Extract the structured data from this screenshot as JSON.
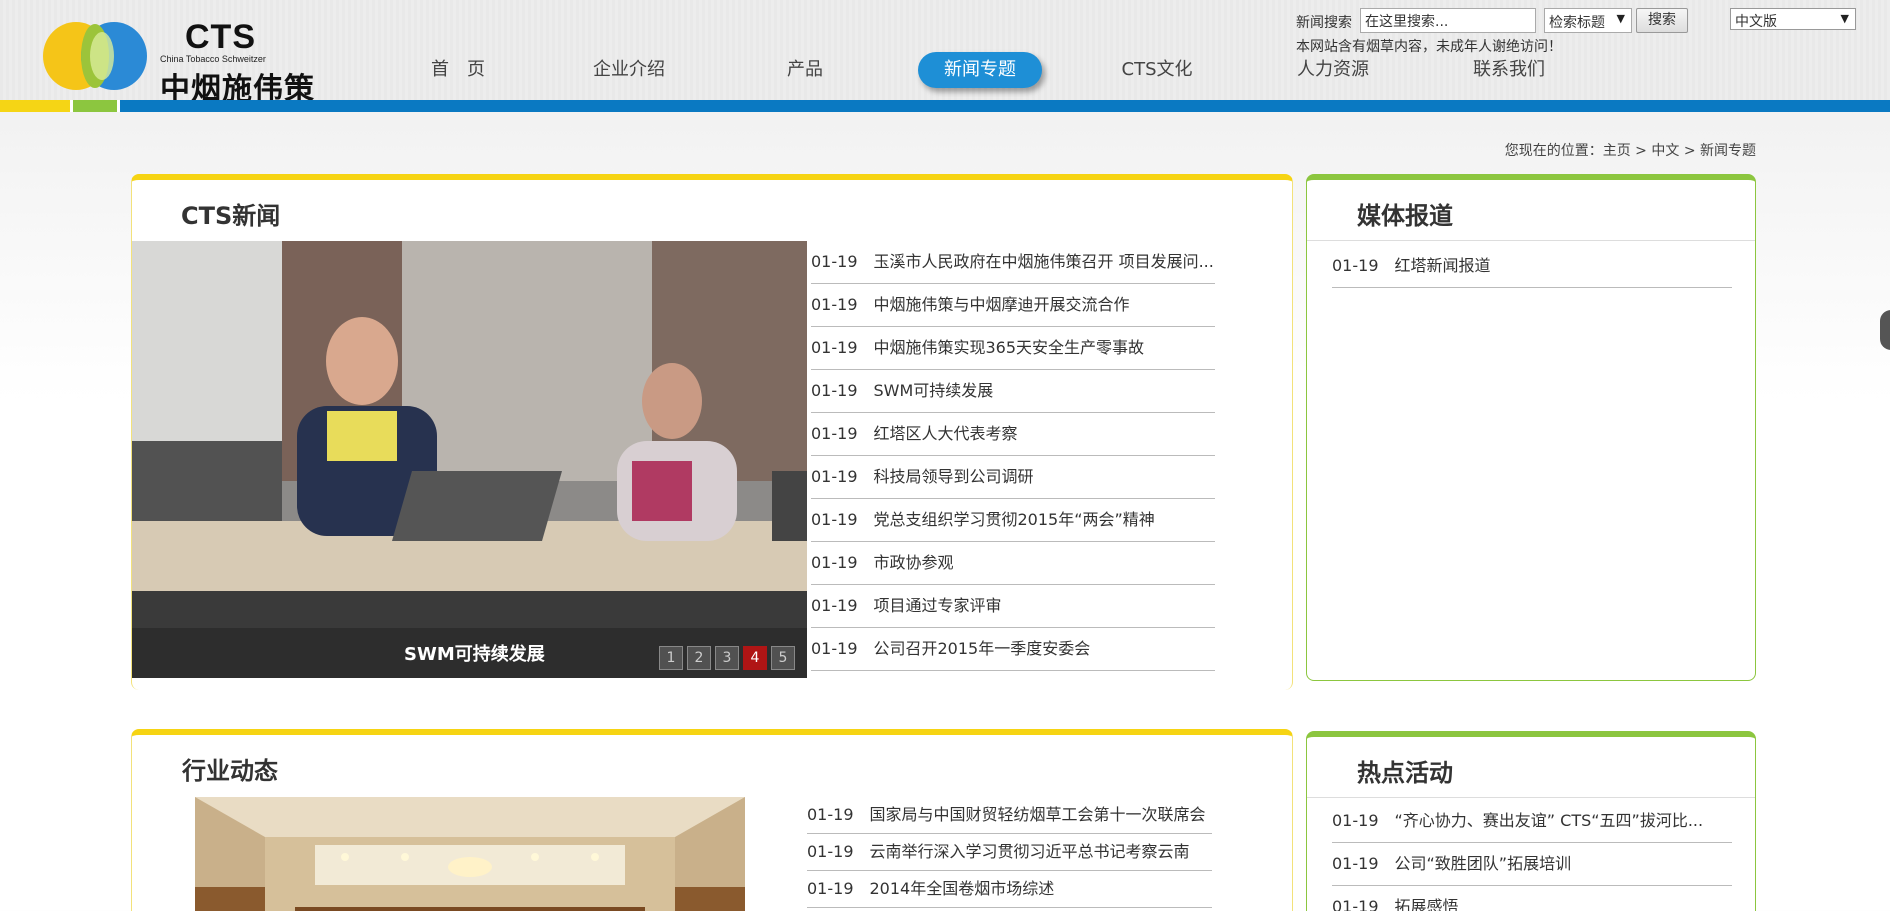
{
  "header": {
    "logo": {
      "brand": "CTS",
      "english": "China Tobacco Schweitzer",
      "chinese": "中烟施伟策"
    },
    "search": {
      "label": "新闻搜索",
      "placeholder": "在这里搜索...",
      "scope": "检索标题",
      "button": "搜索"
    },
    "notice": "本网站含有烟草内容，未成年人谢绝访问！",
    "language": "中文版",
    "nav": [
      {
        "label": "首　页",
        "active": false
      },
      {
        "label": "企业介绍",
        "active": false
      },
      {
        "label": "产品",
        "active": false
      },
      {
        "label": "新闻专题",
        "active": true
      },
      {
        "label": "CTS文化",
        "active": false
      },
      {
        "label": "人力资源",
        "active": false
      },
      {
        "label": "联系我们",
        "active": false
      }
    ],
    "colors": {
      "blue": "#0a79c2",
      "yellow": "#f5d515",
      "green": "#8cc63f"
    }
  },
  "breadcrumb": "您现在的位置：主页 > 中文 > 新闻专题",
  "cts_news": {
    "title": "CTS新闻",
    "slide_caption": "SWM可持续发展",
    "pager": [
      "1",
      "2",
      "3",
      "4",
      "5"
    ],
    "pager_active": "4",
    "items": [
      {
        "date": "01-19",
        "title": "玉溪市人民政府在中烟施伟策召开 项目发展问..."
      },
      {
        "date": "01-19",
        "title": "中烟施伟策与中烟摩迪开展交流合作"
      },
      {
        "date": "01-19",
        "title": "中烟施伟策实现365天安全生产零事故"
      },
      {
        "date": "01-19",
        "title": "SWM可持续发展"
      },
      {
        "date": "01-19",
        "title": "红塔区人大代表考察"
      },
      {
        "date": "01-19",
        "title": "科技局领导到公司调研"
      },
      {
        "date": "01-19",
        "title": "党总支组织学习贯彻2015年“两会”精神"
      },
      {
        "date": "01-19",
        "title": "市政协参观"
      },
      {
        "date": "01-19",
        "title": "项目通过专家评审"
      },
      {
        "date": "01-19",
        "title": "公司召开2015年一季度安委会"
      }
    ]
  },
  "media": {
    "title": "媒体报道",
    "items": [
      {
        "date": "01-19",
        "title": "红塔新闻报道"
      }
    ]
  },
  "industry": {
    "title": "行业动态",
    "items": [
      {
        "date": "01-19",
        "title": "国家局与中国财贸轻纺烟草工会第十一次联席会"
      },
      {
        "date": "01-19",
        "title": "云南举行深入学习贯彻习近平总书记考察云南"
      },
      {
        "date": "01-19",
        "title": "2014年全国卷烟市场综述"
      }
    ]
  },
  "events": {
    "title": "热点活动",
    "items": [
      {
        "date": "01-19",
        "title": "“齐心协力、赛出友谊” CTS“五四”拔河比..."
      },
      {
        "date": "01-19",
        "title": "公司“致胜团队”拓展培训"
      },
      {
        "date": "01-19",
        "title": "拓展感悟"
      }
    ]
  }
}
